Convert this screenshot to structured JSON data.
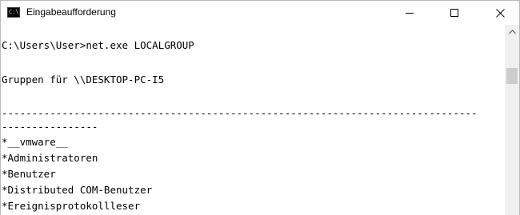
{
  "window": {
    "title": "Eingabeaufforderung",
    "icon_text": "C:\\"
  },
  "console": {
    "lines": [
      "C:\\Users\\User>net.exe LOCALGROUP",
      "",
      "Gruppen für \\\\DESKTOP-PC-I5",
      "",
      "-------------------------------------------------------------------------------",
      "----------------",
      "*__vmware__",
      "*Administratoren",
      "*Benutzer",
      "*Distributed COM-Benutzer",
      "*Ereignisprotokollleser"
    ]
  },
  "icons": {
    "app": "console-icon",
    "minimize": "minimize-icon",
    "maximize": "maximize-icon",
    "close": "close-icon",
    "scroll_up": "scroll-up-arrow-icon"
  },
  "colors": {
    "background": "#ffffff",
    "text": "#000000",
    "scrollbar_track": "#f0f0f0",
    "scrollbar_thumb": "#cdcdcd"
  }
}
